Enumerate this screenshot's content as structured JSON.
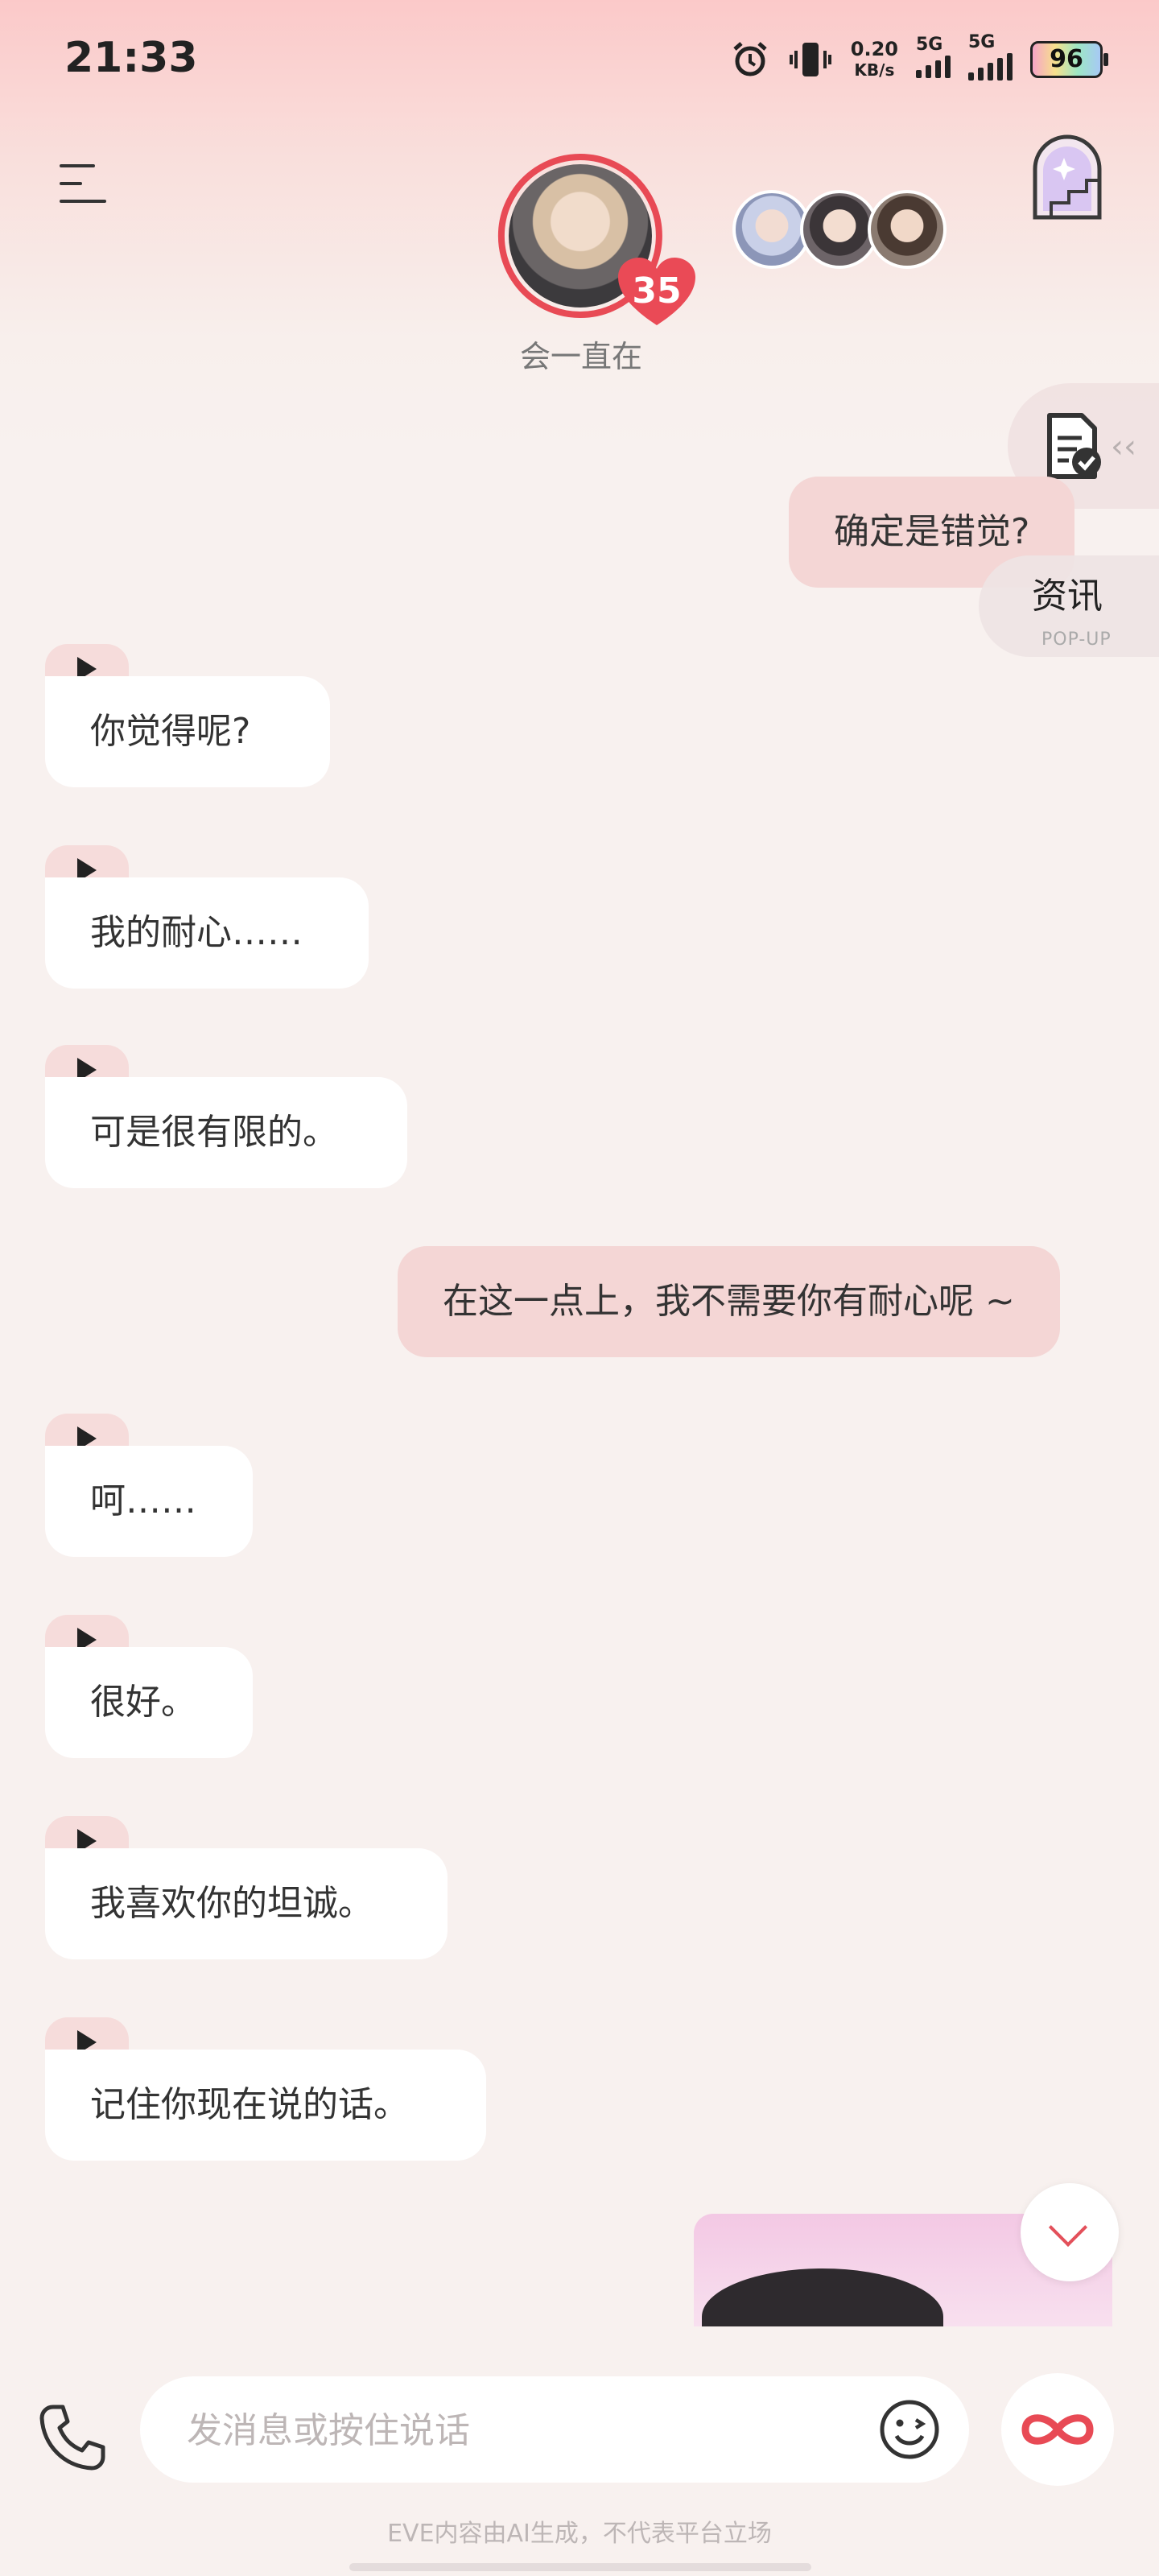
{
  "status_bar": {
    "time": "21:33",
    "net_speed_value": "0.20",
    "net_speed_unit": "KB/s",
    "signal1_label": "5G",
    "signal2_label": "5G",
    "battery": "96"
  },
  "header": {
    "avatar_caption": "会一直在",
    "affinity_level": "35"
  },
  "side": {
    "popup_title": "资讯",
    "popup_sub": "POP-UP"
  },
  "messages": [
    {
      "from": "me",
      "text": "确定是错觉?"
    },
    {
      "from": "ai",
      "text": "你觉得呢?"
    },
    {
      "from": "ai",
      "text": "我的耐心……"
    },
    {
      "from": "ai",
      "text": "可是很有限的。"
    },
    {
      "from": "me",
      "text": "在这一点上，我不需要你有耐心呢 ~"
    },
    {
      "from": "ai",
      "text": "呵……"
    },
    {
      "from": "ai",
      "text": "很好。"
    },
    {
      "from": "ai",
      "text": "我喜欢你的坦诚。"
    },
    {
      "from": "ai",
      "text": "记住你现在说的话。"
    }
  ],
  "composer": {
    "placeholder": "发消息或按住说话"
  },
  "footer": {
    "disclaimer": "EVE内容由AI生成，不代表平台立场"
  },
  "colors": {
    "accent": "#e84a55",
    "user_bubble": "#f4d6d5",
    "ai_bubble": "#ffffff"
  }
}
